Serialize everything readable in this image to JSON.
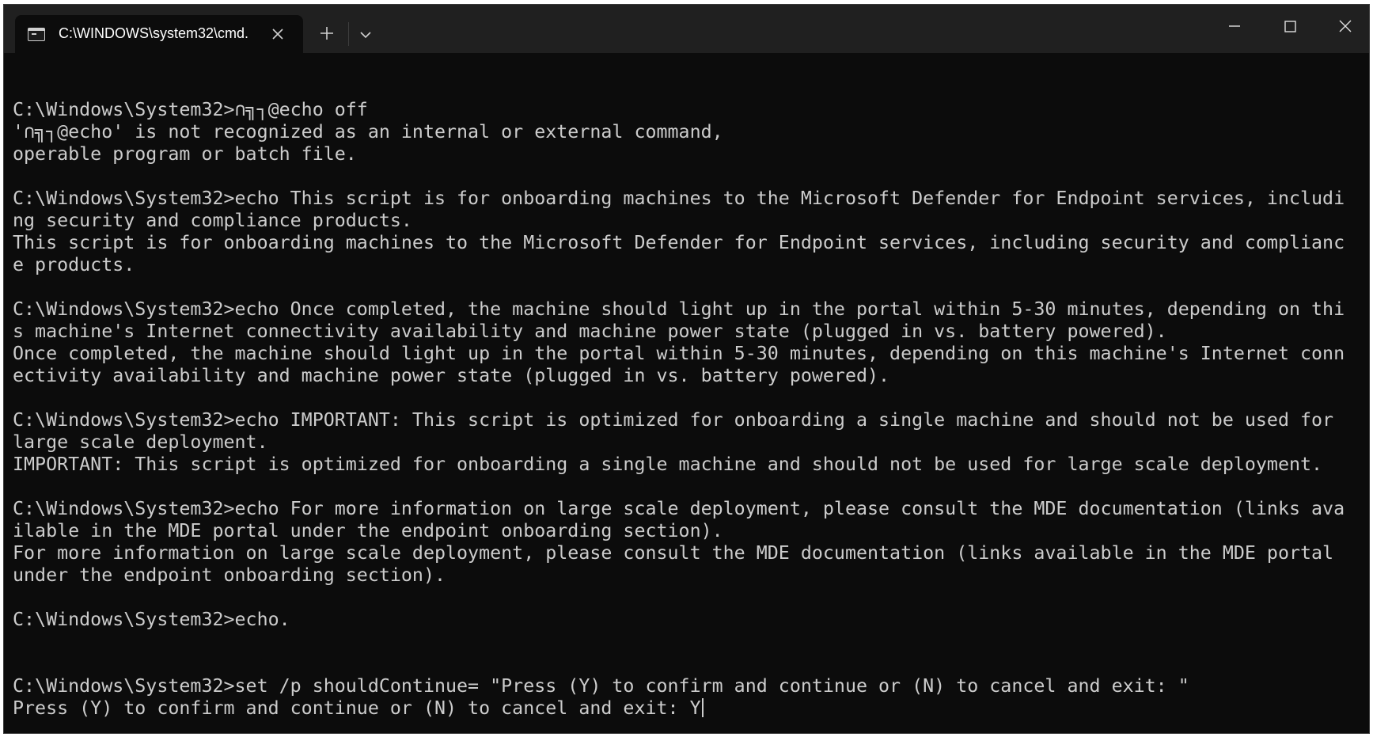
{
  "window": {
    "tab_title": "C:\\WINDOWS\\system32\\cmd.",
    "icons": {
      "tab": "terminal-icon",
      "close_tab": "close-icon",
      "new_tab": "plus-icon",
      "dropdown": "chevron-down-icon",
      "minimize": "minimize-icon",
      "maximize": "maximize-icon",
      "close_window": "close-icon"
    }
  },
  "colors": {
    "console_background": "#0c0c0c",
    "console_text": "#cccccc",
    "titlebar": "#202020"
  },
  "console": {
    "lines": [
      "",
      "C:\\Windows\\System32>∩╗┐@echo off",
      "'∩╗┐@echo' is not recognized as an internal or external command,",
      "operable program or batch file.",
      "",
      "C:\\Windows\\System32>echo This script is for onboarding machines to the Microsoft Defender for Endpoint services, includi",
      "ng security and compliance products.",
      "This script is for onboarding machines to the Microsoft Defender for Endpoint services, including security and complianc",
      "e products.",
      "",
      "C:\\Windows\\System32>echo Once completed, the machine should light up in the portal within 5-30 minutes, depending on thi",
      "s machine's Internet connectivity availability and machine power state (plugged in vs. battery powered).",
      "Once completed, the machine should light up in the portal within 5-30 minutes, depending on this machine's Internet conn",
      "ectivity availability and machine power state (plugged in vs. battery powered).",
      "",
      "C:\\Windows\\System32>echo IMPORTANT: This script is optimized for onboarding a single machine and should not be used for",
      "large scale deployment.",
      "IMPORTANT: This script is optimized for onboarding a single machine and should not be used for large scale deployment.",
      "",
      "C:\\Windows\\System32>echo For more information on large scale deployment, please consult the MDE documentation (links ava",
      "ilable in the MDE portal under the endpoint onboarding section).",
      "For more information on large scale deployment, please consult the MDE documentation (links available in the MDE portal",
      "under the endpoint onboarding section).",
      "",
      "C:\\Windows\\System32>echo.",
      "",
      "",
      "C:\\Windows\\System32>set /p shouldContinue= \"Press (Y) to confirm and continue or (N) to cancel and exit: \"",
      "Press (Y) to confirm and continue or (N) to cancel and exit: Y"
    ]
  }
}
